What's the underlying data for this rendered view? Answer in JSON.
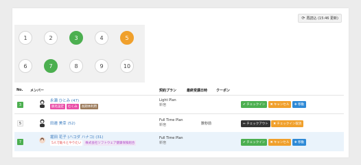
{
  "reload": {
    "label": "再読込 (15:46 更新)",
    "icon": "refresh-icon"
  },
  "seats": [
    {
      "n": "1",
      "status": "empty"
    },
    {
      "n": "2",
      "status": "empty"
    },
    {
      "n": "3",
      "status": "green"
    },
    {
      "n": "4",
      "status": "empty"
    },
    {
      "n": "5",
      "status": "orange"
    },
    {
      "n": "6",
      "status": "empty"
    },
    {
      "n": "7",
      "status": "green"
    },
    {
      "n": "8",
      "status": "empty"
    },
    {
      "n": "9",
      "status": "empty"
    },
    {
      "n": "10",
      "status": "empty"
    }
  ],
  "table": {
    "headers": {
      "no": "No.",
      "member": "メンバー",
      "plan": "契約プラン",
      "last": "最終受講日時",
      "coupon": "クーポン"
    },
    "rows": [
      {
        "no": "3",
        "name": "永瀬 ひとみ (47)",
        "tags": [
          {
            "text": "脱毛設定",
            "color": "#e94fa8"
          },
          {
            "text": "むくみ",
            "color": "#e94fa8"
          },
          {
            "text": "長期休利用",
            "color": "#9b7a5a"
          }
        ],
        "plan": "Light Plan",
        "plan_sub": "新宿",
        "last": "",
        "buttons": [
          {
            "label": "✔ チェックイン",
            "color": "green"
          },
          {
            "label": "✖ キャンセル",
            "color": "orange"
          },
          {
            "label": "✥ 移動",
            "color": "blue"
          }
        ]
      },
      {
        "no": "5",
        "name": "田邉 美幸 (52)",
        "tags": [],
        "plan": "Full Time Plan",
        "plan_sub": "新宿",
        "last": "数秒前",
        "buttons": [
          {
            "label": "↦ チェックアウト",
            "color": "dark"
          },
          {
            "label": "✖ チェックイン取消",
            "color": "orange"
          }
        ]
      },
      {
        "no": "7",
        "name": "堀田 花子 (ハコダ ハナコ) (31)",
        "tags": [
          {
            "text": "5人で助々とやりたい",
            "color": "#f5f5f5",
            "fg": "#e23b3b"
          },
          {
            "text": "株式会社ソフトウェア健康保険組合",
            "color": "#f2eaf7",
            "fg": "#b04bc8"
          }
        ],
        "plan": "Full Time Plan",
        "plan_sub": "新宿",
        "last": "",
        "buttons": [
          {
            "label": "✔ チェックイン",
            "color": "green"
          },
          {
            "label": "✖ キャンセル",
            "color": "orange"
          },
          {
            "label": "✥ 移動",
            "color": "blue"
          }
        ]
      }
    ]
  }
}
